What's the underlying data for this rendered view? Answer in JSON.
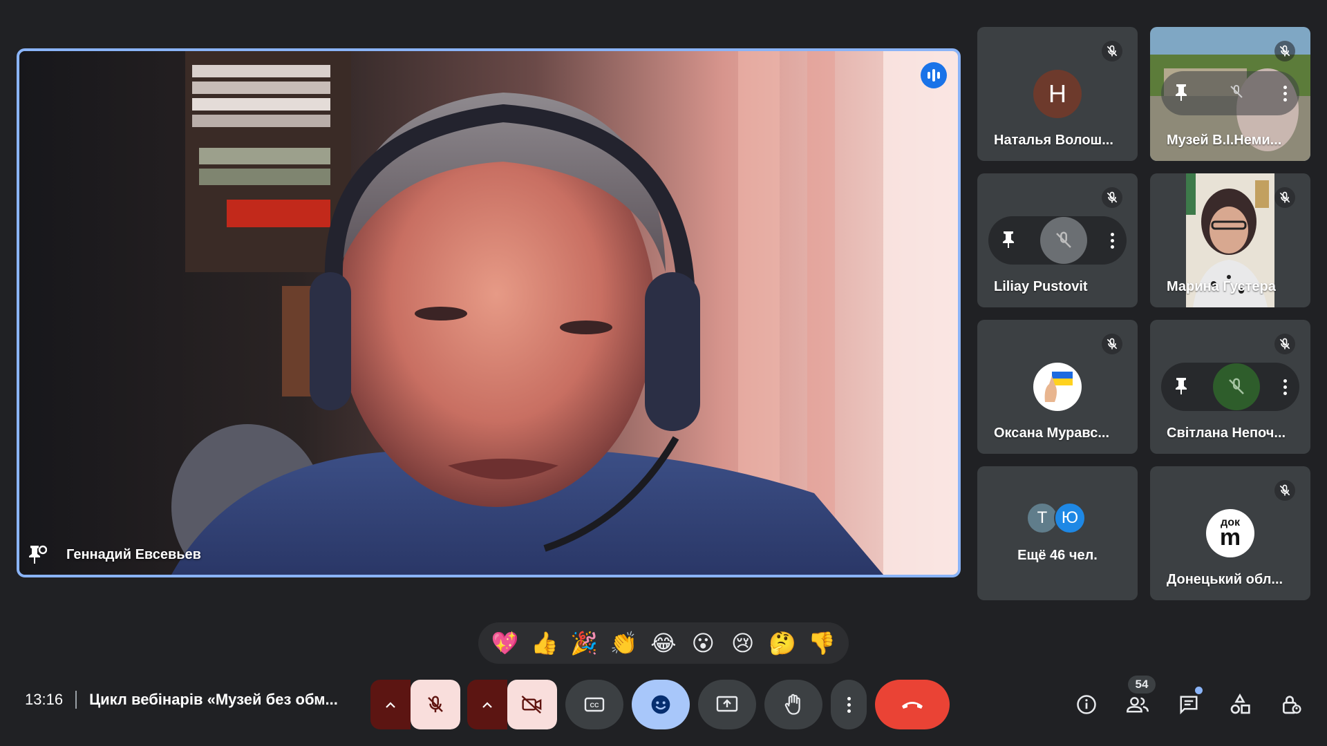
{
  "main_speaker": {
    "name": "Геннадий Евсевьев",
    "speaking": true
  },
  "participants": [
    {
      "name": "Наталья Волош...",
      "avatar_letter": "H",
      "avatar_color": "#6d3a2c",
      "muted": true,
      "type": "letter"
    },
    {
      "name": "Музей В.І.Неми...",
      "muted": true,
      "type": "video-hover"
    },
    {
      "name": "Liliay Pustovit",
      "muted": true,
      "type": "hover"
    },
    {
      "name": "Марина Густера",
      "muted": true,
      "type": "video"
    },
    {
      "name": "Оксана Муравс...",
      "muted": true,
      "type": "flag"
    },
    {
      "name": "Світлана Непоч...",
      "muted": true,
      "type": "hover-green"
    },
    {
      "name": "Донецький обл...",
      "muted": true,
      "type": "logo",
      "logo_text_top": "док",
      "logo_text_main": "m"
    }
  ],
  "more_people": {
    "label": "Ещё 46 чел.",
    "avatars": [
      {
        "letter": "Т",
        "color": "#607d8b"
      },
      {
        "letter": "Ю",
        "color": "#1e88e5"
      }
    ]
  },
  "reactions": [
    "💖",
    "👍",
    "🎉",
    "👏",
    "😂",
    "😮",
    "😢",
    "🤔",
    "👎"
  ],
  "meeting": {
    "time": "13:16",
    "title": "Цикл вебінарів «Музей без обм..."
  },
  "participant_count": "54",
  "colors": {
    "background": "#202124",
    "tile": "#3c4043",
    "active_border": "#8ab4f8",
    "hangup": "#ea4335",
    "mic_off_bg": "#f9dedc"
  }
}
